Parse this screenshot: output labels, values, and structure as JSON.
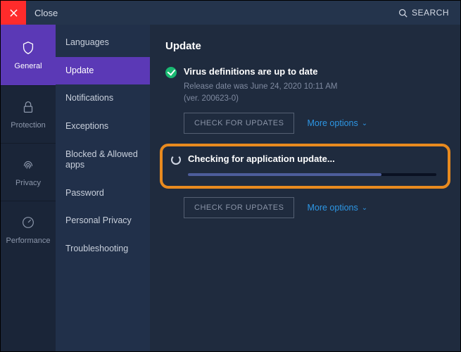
{
  "titlebar": {
    "close_label": "Close",
    "search_label": "SEARCH"
  },
  "iconbar": {
    "items": [
      {
        "label": "General"
      },
      {
        "label": "Protection"
      },
      {
        "label": "Privacy"
      },
      {
        "label": "Performance"
      }
    ]
  },
  "sub_sidebar": {
    "items": [
      {
        "label": "Languages"
      },
      {
        "label": "Update"
      },
      {
        "label": "Notifications"
      },
      {
        "label": "Exceptions"
      },
      {
        "label": "Blocked & Allowed apps"
      },
      {
        "label": "Password"
      },
      {
        "label": "Personal Privacy"
      },
      {
        "label": "Troubleshooting"
      }
    ]
  },
  "page": {
    "title": "Update",
    "virus": {
      "status": "Virus definitions are up to date",
      "release_line": "Release date was June 24, 2020 10:11 AM",
      "ver_line": "(ver. 200623-0)",
      "check_btn": "CHECK FOR UPDATES",
      "more": "More options"
    },
    "app": {
      "status": "Checking for application update...",
      "progress_pct": 78,
      "check_btn": "CHECK FOR UPDATES",
      "more": "More options"
    }
  }
}
